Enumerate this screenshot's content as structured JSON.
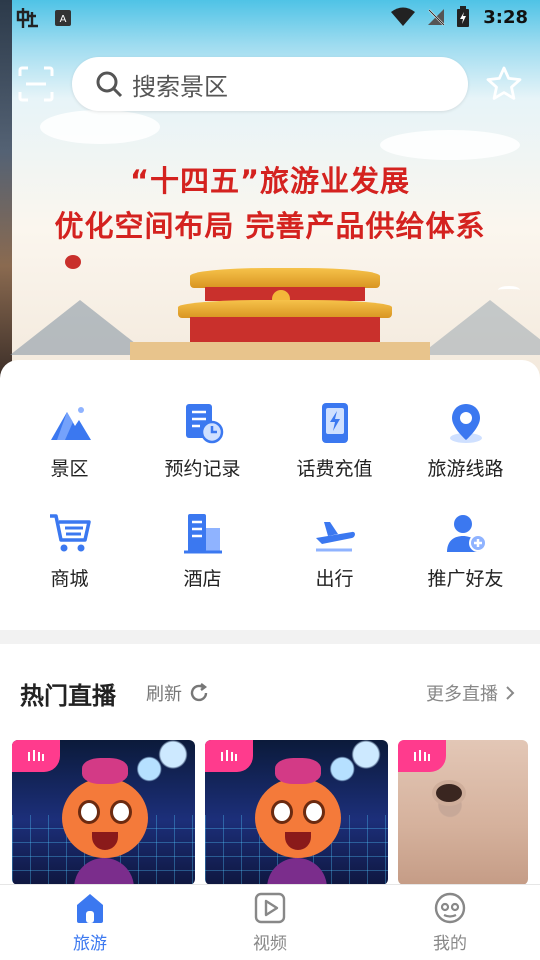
{
  "status_bar": {
    "time": "3:28"
  },
  "search": {
    "placeholder": "搜索景区"
  },
  "banner": {
    "line1": "“十四五”旅游业发展",
    "line2": "优化空间布局 完善产品供给体系"
  },
  "menu": {
    "items": [
      {
        "label": "景区",
        "icon": "mountain-icon"
      },
      {
        "label": "预约记录",
        "icon": "booking-record-icon"
      },
      {
        "label": "话费充值",
        "icon": "phone-recharge-icon"
      },
      {
        "label": "旅游线路",
        "icon": "map-pin-icon"
      },
      {
        "label": "商城",
        "icon": "cart-icon"
      },
      {
        "label": "酒店",
        "icon": "hotel-icon"
      },
      {
        "label": "出行",
        "icon": "plane-icon"
      },
      {
        "label": "推广好友",
        "icon": "add-friend-icon"
      }
    ]
  },
  "live": {
    "title": "热门直播",
    "refresh_label": "刷新",
    "more_label": "更多直播"
  },
  "tabbar": {
    "items": [
      {
        "label": "旅游",
        "icon": "home-icon",
        "active": true
      },
      {
        "label": "视频",
        "icon": "video-icon",
        "active": false
      },
      {
        "label": "我的",
        "icon": "profile-icon",
        "active": false
      }
    ]
  },
  "colors": {
    "accent": "#3b78f0",
    "banner_text": "#d4221f",
    "live_badge": "#ff3b8d",
    "inactive_tab": "#888888"
  }
}
